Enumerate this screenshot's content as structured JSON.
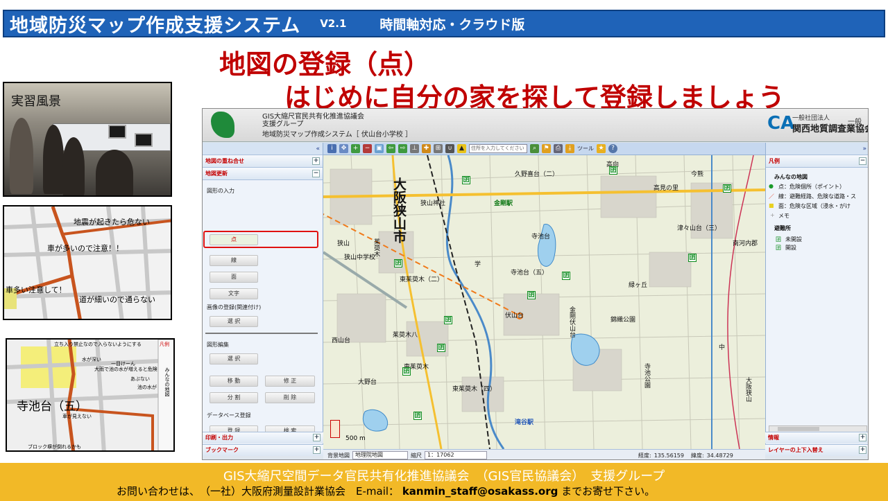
{
  "header": {
    "title": "地域防災マップ作成支援システム",
    "version": "V2.1",
    "subtitle": "時間軸対応・クラウド版",
    "bg": "#1f63b8"
  },
  "slide": {
    "title": "地図の登録（点）",
    "instruction": "はじめに自分の家を探して登録しましょう",
    "accent": "#c00000"
  },
  "photos": {
    "p1_caption": "実習風景",
    "p2_labels": [
      "地震が起きたら危ない",
      "車が多いので注意！！",
      "車多い注意して！",
      "道が細いので通らない"
    ],
    "p3_labels": [
      "立ち入り禁止なので入らないようにする",
      "寺池台（五）",
      "凡例",
      "みんなの地図",
      "車が見えない",
      "水が深い",
      "一目けーん",
      "大雨で池の水が増えると危険",
      "あぶない",
      "池の水が",
      "ブロック塀が倒れるかも"
    ]
  },
  "app": {
    "org_line1": "GIS大縮尺官民共有化推進協議会",
    "org_line2": "支援グループ",
    "system_title": "地域防災マップ作成システム［ 伏山台小学校 ］",
    "right_org_small": "一般社団法人",
    "right_org": "関西地質調査業協会",
    "right_side": "一般",
    "toolbar": {
      "address_placeholder": "住所を入力してください",
      "tools_label": "ツール",
      "collapse_left": "«",
      "collapse_right": "»"
    },
    "left_panel": {
      "sections": [
        {
          "label": "地図の重ね合せ",
          "toggle": "+"
        },
        {
          "label": "地図更新",
          "toggle": "−"
        }
      ],
      "shape_input_label": "図形の入力",
      "buttons": {
        "point": "点",
        "line": "線",
        "polygon": "面",
        "text": "文字",
        "image_label": "画像の登録(関連付け)",
        "select1": "選 択",
        "edit_label": "図形編集",
        "select2": "選 択",
        "move": "移 動",
        "modify": "修 正",
        "split": "分 割",
        "delete": "削 除",
        "db_label": "データベース登録",
        "register": "登 録",
        "search": "検 索"
      },
      "bottom_sections": [
        {
          "label": "印刷・出力",
          "toggle": "+"
        },
        {
          "label": "ブックマーク",
          "toggle": "+"
        }
      ]
    },
    "right_panel": {
      "legend_title": "凡例",
      "group_title": "みんなの地図",
      "items": [
        "点：危険個所（ポイント）",
        "線：避難経路、危険な道路・ス",
        "面：危険な区域（浸水・がけ",
        "メモ"
      ],
      "shelter_title": "避難所",
      "shelter_items": [
        "未開設",
        "開設"
      ],
      "bottom_sections": [
        {
          "label": "情報",
          "toggle": "+"
        },
        {
          "label": "レイヤーの上下入替え",
          "toggle": "+"
        }
      ]
    },
    "map": {
      "places": [
        "大阪狭山市",
        "狭山神社",
        "金剛駅",
        "寺池台（五）",
        "東茱萸木（二）",
        "伏山台",
        "金剛伏山台",
        "東茱萸木",
        "大野台",
        "西山台",
        "寺池公園",
        "大阪狭山",
        "高向",
        "津々山台（三）",
        "久野喜台（二）",
        "寺池台",
        "高見の里",
        "今熊",
        "茱萸木",
        "狭山",
        "南河内郡",
        "錦織公園",
        "中",
        "緑ヶ丘",
        "学",
        "狭山中学校",
        "茱萸木八",
        "東茱萸木（四）",
        "滝谷駅"
      ],
      "scale_text": "500 m"
    },
    "status_bar": {
      "background_label": "背景地図",
      "background_value": "地理院地図",
      "scale_label": "縮尺",
      "scale_value": "1：17062",
      "lon_label": "経度:",
      "lon_value": "135.56159",
      "lat_label": "緯度:",
      "lat_value": "34.48729"
    }
  },
  "footer": {
    "line1": "GIS大縮尺空間データ官民共有化推進協議会　（GIS官民協議会）　支援グループ",
    "line2_prefix": "お問い合わせは、　（一社）大阪府測量設計業協会　E-mail：",
    "email": "kanmin_staff@osakass.org",
    "line2_suffix": "までお寄せ下さい。",
    "bg": "#f2b927"
  }
}
